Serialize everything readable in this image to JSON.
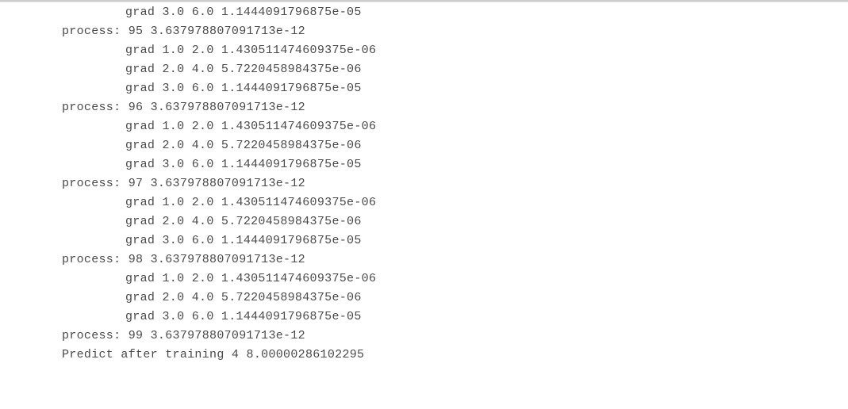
{
  "lines": [
    {
      "indent": true,
      "text": "grad 3.0 6.0 1.1444091796875e-05"
    },
    {
      "indent": false,
      "text": "process: 95 3.637978807091713e-12"
    },
    {
      "indent": true,
      "text": "grad 1.0 2.0 1.430511474609375e-06"
    },
    {
      "indent": true,
      "text": "grad 2.0 4.0 5.7220458984375e-06"
    },
    {
      "indent": true,
      "text": "grad 3.0 6.0 1.1444091796875e-05"
    },
    {
      "indent": false,
      "text": "process: 96 3.637978807091713e-12"
    },
    {
      "indent": true,
      "text": "grad 1.0 2.0 1.430511474609375e-06"
    },
    {
      "indent": true,
      "text": "grad 2.0 4.0 5.7220458984375e-06"
    },
    {
      "indent": true,
      "text": "grad 3.0 6.0 1.1444091796875e-05"
    },
    {
      "indent": false,
      "text": "process: 97 3.637978807091713e-12"
    },
    {
      "indent": true,
      "text": "grad 1.0 2.0 1.430511474609375e-06"
    },
    {
      "indent": true,
      "text": "grad 2.0 4.0 5.7220458984375e-06"
    },
    {
      "indent": true,
      "text": "grad 3.0 6.0 1.1444091796875e-05"
    },
    {
      "indent": false,
      "text": "process: 98 3.637978807091713e-12"
    },
    {
      "indent": true,
      "text": "grad 1.0 2.0 1.430511474609375e-06"
    },
    {
      "indent": true,
      "text": "grad 2.0 4.0 5.7220458984375e-06"
    },
    {
      "indent": true,
      "text": "grad 3.0 6.0 1.1444091796875e-05"
    },
    {
      "indent": false,
      "text": "process: 99 3.637978807091713e-12"
    },
    {
      "indent": false,
      "text": "Predict after training 4 8.00000286102295"
    }
  ]
}
